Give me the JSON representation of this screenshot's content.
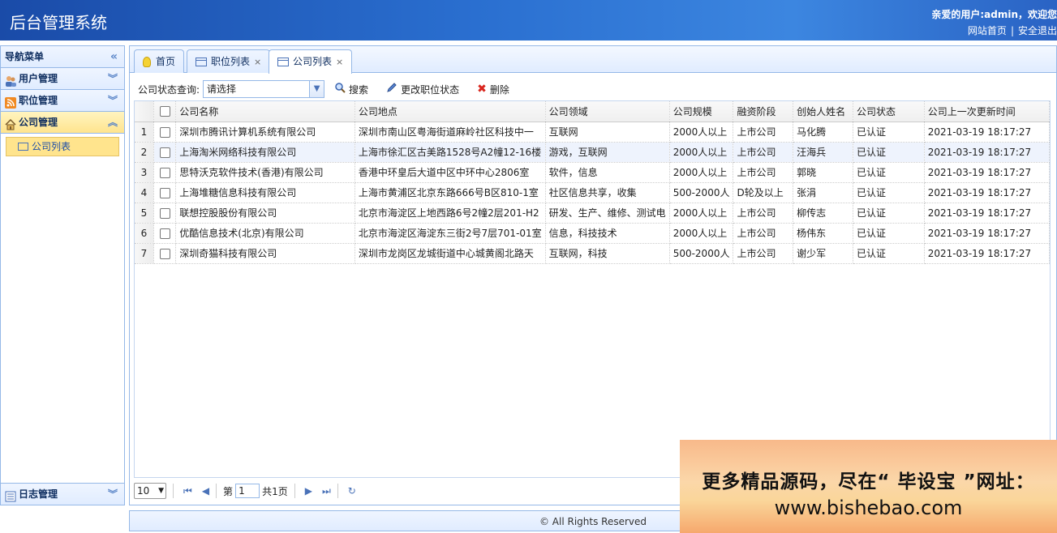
{
  "header": {
    "title": "后台管理系统",
    "welcome": "亲爱的用户:admin，欢迎您",
    "link_home": "网站首页",
    "link_sep": "|",
    "link_logout": "安全退出"
  },
  "nav": {
    "title": "导航菜单",
    "collapse_glyph": "«",
    "sections": {
      "user": "用户管理",
      "job": "职位管理",
      "company": "公司管理",
      "log": "日志管理"
    },
    "company_items": [
      "公司列表"
    ]
  },
  "tabs": [
    {
      "label": "首页",
      "closable": false
    },
    {
      "label": "职位列表",
      "closable": true
    },
    {
      "label": "公司列表",
      "closable": true
    }
  ],
  "toolbar": {
    "filter_label": "公司状态查询:",
    "filter_value": "请选择",
    "search": "搜索",
    "change_status": "更改职位状态",
    "delete": "删除"
  },
  "table": {
    "columns": [
      "公司名称",
      "公司地点",
      "公司领域",
      "公司规模",
      "融资阶段",
      "创始人姓名",
      "公司状态",
      "公司上一次更新时间"
    ],
    "rows": [
      [
        "1",
        "深圳市腾讯计算机系统有限公司",
        "深圳市南山区粤海街道麻岭社区科技中一",
        "互联网",
        "2000人以上",
        "上市公司",
        "马化腾",
        "已认证",
        "2021-03-19 18:17:27"
      ],
      [
        "2",
        "上海淘米网络科技有限公司",
        "上海市徐汇区古美路1528号A2幢12-16楼",
        "游戏，互联网",
        "2000人以上",
        "上市公司",
        "汪海兵",
        "已认证",
        "2021-03-19 18:17:27"
      ],
      [
        "3",
        "思特沃克软件技术(香港)有限公司",
        "香港中环皇后大道中区中环中心2806室",
        "软件，信息",
        "2000人以上",
        "上市公司",
        "郭晓",
        "已认证",
        "2021-03-19 18:17:27"
      ],
      [
        "4",
        "上海堆糖信息科技有限公司",
        "上海市黄浦区北京东路666号B区810-1室",
        "社区信息共享，收集",
        "500-2000人",
        "D轮及以上",
        "张涓",
        "已认证",
        "2021-03-19 18:17:27"
      ],
      [
        "5",
        "联想控股股份有限公司",
        "北京市海淀区上地西路6号2幢2层201-H2",
        "研发、生产、维修、测试电",
        "2000人以上",
        "上市公司",
        "柳传志",
        "已认证",
        "2021-03-19 18:17:27"
      ],
      [
        "6",
        "优酷信息技术(北京)有限公司",
        "北京市海淀区海淀东三街2号7层701-01室",
        "信息，科技技术",
        "2000人以上",
        "上市公司",
        "杨伟东",
        "已认证",
        "2021-03-19 18:17:27"
      ],
      [
        "7",
        "深圳奇猫科技有限公司",
        "深圳市龙岗区龙城街道中心城黄阁北路天",
        "互联网，科技",
        "500-2000人",
        "上市公司",
        "谢少军",
        "已认证",
        "2021-03-19 18:17:27"
      ]
    ]
  },
  "pager": {
    "page_size": "10",
    "page_prefix": "第",
    "page_value": "1",
    "page_total": "共1页"
  },
  "footer": "© All Rights Reserved",
  "banner": {
    "line1": "更多精品源码，尽在“ 毕设宝 ”网址：",
    "line2": "www.bishebao.com"
  },
  "colors": {
    "header_blue": "#2a6fd0",
    "panel_border": "#95b8e7",
    "active_yellow": "#ffe48d",
    "delete_red": "#d9251d"
  }
}
